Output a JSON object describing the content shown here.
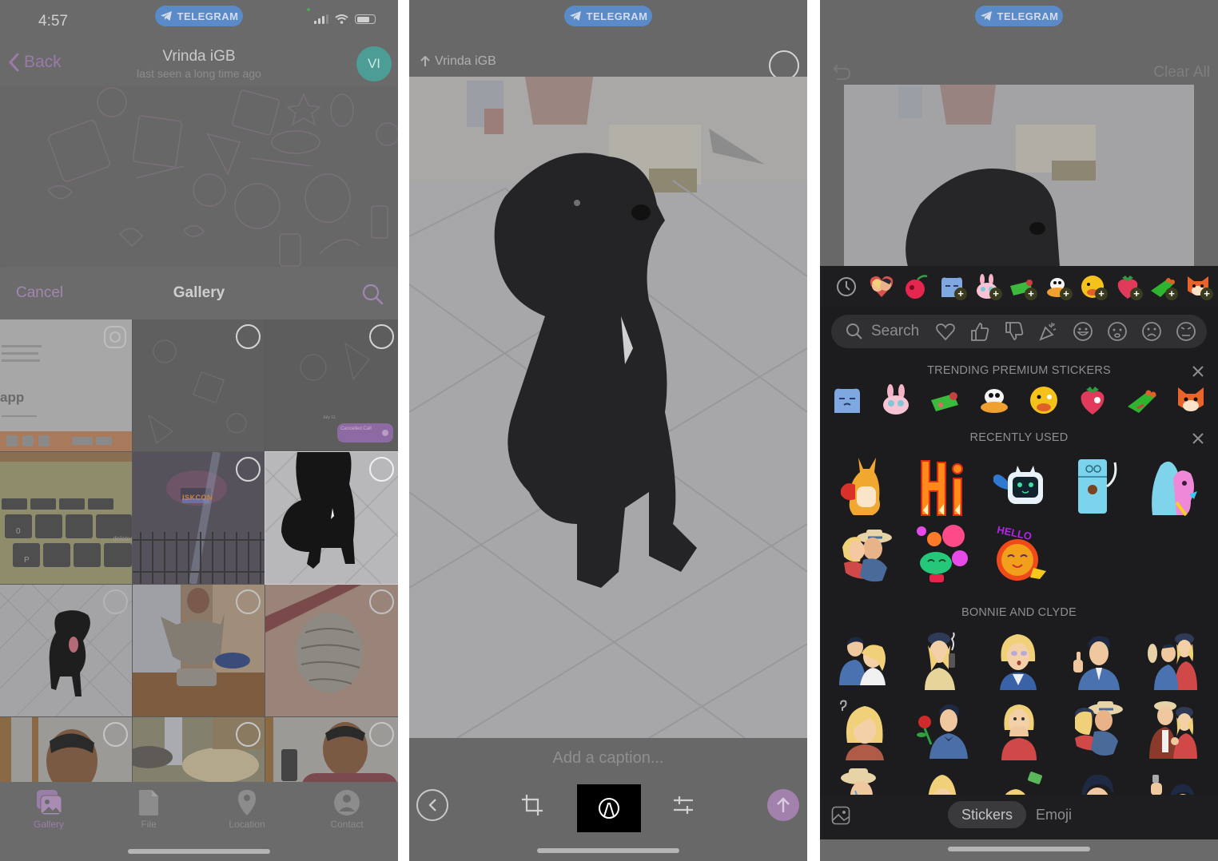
{
  "badge": {
    "label": "TELEGRAM",
    "icon": "telegram-plane-icon",
    "color": "#5a8ac8"
  },
  "panel1": {
    "status_bar": {
      "time": "4:57",
      "icons": [
        "cellular-signal-icon",
        "wifi-icon",
        "battery-icon"
      ]
    },
    "chat_header": {
      "back_label": "Back",
      "title": "Vrinda iGB",
      "subtitle": "last seen a long time ago",
      "avatar_initials": "VI",
      "avatar_color": "#4d9d97"
    },
    "gallery": {
      "cancel_label": "Cancel",
      "title": "Gallery",
      "search_icon": "search-icon",
      "photos": [
        {
          "subject": "screenshot with app text",
          "overlay_text": "app",
          "selection": "camera-icon"
        },
        {
          "subject": "chat wallpaper screenshot",
          "selection": "unselected"
        },
        {
          "subject": "chat screenshot with cancelled call",
          "overlay_text": "Cancelled Call",
          "date_text": "July 11",
          "selection": "unselected"
        },
        {
          "subject": "laptop keyboard",
          "overlay_text": "delete",
          "selection": "none"
        },
        {
          "subject": "ISKCON temple at night",
          "overlay_text": "ISKCON",
          "selection": "unselected"
        },
        {
          "subject": "black puppy sitting on tiles",
          "selection": "unselected",
          "highlighted": true
        },
        {
          "subject": "black puppy with tongue out",
          "selection": "unselected"
        },
        {
          "subject": "cat eating from bowl",
          "selection": "unselected"
        },
        {
          "subject": "cat sleeping curled up",
          "selection": "unselected"
        },
        {
          "subject": "young man portrait",
          "selection": "unselected"
        },
        {
          "subject": "table with food",
          "selection": "unselected"
        },
        {
          "subject": "man holding phone",
          "selection": "unselected"
        }
      ]
    },
    "attach_tabs": [
      {
        "label": "Gallery",
        "icon": "gallery-icon",
        "active": true
      },
      {
        "label": "File",
        "icon": "file-icon",
        "active": false
      },
      {
        "label": "Location",
        "icon": "location-pin-icon",
        "active": false
      },
      {
        "label": "Contact",
        "icon": "contact-icon",
        "active": false
      }
    ],
    "accent_color": "#a286b0"
  },
  "panel2": {
    "recipient": "Vrinda iGB",
    "caption_placeholder": "Add a caption...",
    "photo_subject": "black puppy sitting on patterned tiles",
    "toolbar": [
      {
        "name": "back",
        "icon": "chevron-left-circle-icon"
      },
      {
        "name": "crop",
        "icon": "crop-icon"
      },
      {
        "name": "draw",
        "icon": "markup-pen-icon",
        "active": true
      },
      {
        "name": "adjust",
        "icon": "sliders-icon"
      },
      {
        "name": "send",
        "icon": "arrow-up-icon"
      }
    ]
  },
  "panel3": {
    "clear_all_label": "Clear All",
    "undo_icon": "undo-icon",
    "pack_row": [
      {
        "icon": "recent-clock-icon"
      },
      {
        "icon": "sticker-couple-kiss"
      },
      {
        "icon": "sticker-cherry"
      },
      {
        "icon": "sticker-blue-cat",
        "add": true
      },
      {
        "icon": "sticker-pink-bunny",
        "add": true
      },
      {
        "icon": "sticker-green-box",
        "add": true
      },
      {
        "icon": "sticker-white-duck",
        "add": true
      },
      {
        "icon": "sticker-yellow-duck",
        "add": true
      },
      {
        "icon": "sticker-strawberry",
        "add": true
      },
      {
        "icon": "sticker-green-frog",
        "add": true
      },
      {
        "icon": "sticker-fox",
        "add": true
      }
    ],
    "search": {
      "placeholder": "Search",
      "emoji_filters": [
        "heart-icon",
        "thumbs-up-icon",
        "thumbs-down-icon",
        "party-popper-icon",
        "grinning-face-icon",
        "anxious-face-icon",
        "frowning-face-icon",
        "angry-face-icon"
      ]
    },
    "sections": {
      "trending": {
        "title": "TRENDING PREMIUM STICKERS",
        "items": [
          "blue-cat",
          "pink-bunny",
          "green-box",
          "white-duck",
          "yellow-duck",
          "strawberry",
          "green-frog",
          "fox"
        ]
      },
      "recent": {
        "title": "RECENTLY USED",
        "items": [
          "kangaroo-boxer",
          "fire-hi",
          "robot-wave",
          "fridge-cookie",
          "monster-hug",
          "couple-kiss",
          "frog-balloons",
          "cat-hello"
        ]
      },
      "pack": {
        "title": "BONNIE AND CLYDE",
        "items": [
          "couple-laugh",
          "bonnie-smoking-gun",
          "bonnie-shocked",
          "clyde-thumbs-up",
          "couple-hat",
          "bonnie-question",
          "clyde-rose",
          "bonnie-hands-face",
          "couple-kiss",
          "couple-fistbump",
          "clyde-crying-hat",
          "bonnie-sly",
          "bonnie-money",
          "clyde-grin",
          "clyde-fist"
        ]
      }
    },
    "tabs": {
      "stickers_label": "Stickers",
      "emoji_label": "Emoji",
      "active": "Stickers"
    }
  }
}
